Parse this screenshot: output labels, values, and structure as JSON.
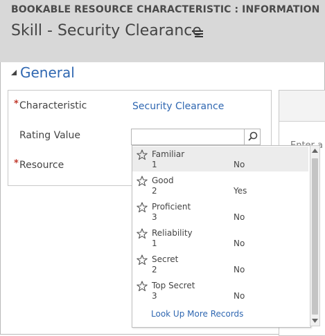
{
  "header": {
    "entity_label": "BOOKABLE RESOURCE CHARACTERISTIC : INFORMATION",
    "record_title": "Skill - Security Clearance"
  },
  "section": {
    "title": "General",
    "toggle_icon": "collapse-triangle-icon"
  },
  "form": {
    "required_marker": "*",
    "characteristic_label": "Characteristic",
    "characteristic_value": "Security Clearance",
    "rating_label": "Rating Value",
    "rating_value": "",
    "resource_label": "Resource"
  },
  "right_panel": {
    "partial_text": "Enter a"
  },
  "lookup": {
    "options": [
      {
        "name": "Familiar",
        "value": "1",
        "flag": "No"
      },
      {
        "name": "Good",
        "value": "2",
        "flag": "Yes"
      },
      {
        "name": "Proficient",
        "value": "3",
        "flag": "No"
      },
      {
        "name": "Reliability",
        "value": "1",
        "flag": "No"
      },
      {
        "name": "Secret",
        "value": "2",
        "flag": "No"
      },
      {
        "name": "Top Secret",
        "value": "3",
        "flag": "No"
      }
    ],
    "more_link": "Look Up More Records",
    "option_icon": "star-icon"
  },
  "colors": {
    "accent": "#2f67b1",
    "header_bg": "#d8d8d8",
    "required": "#c0392b",
    "selected_row": "#ececec"
  }
}
